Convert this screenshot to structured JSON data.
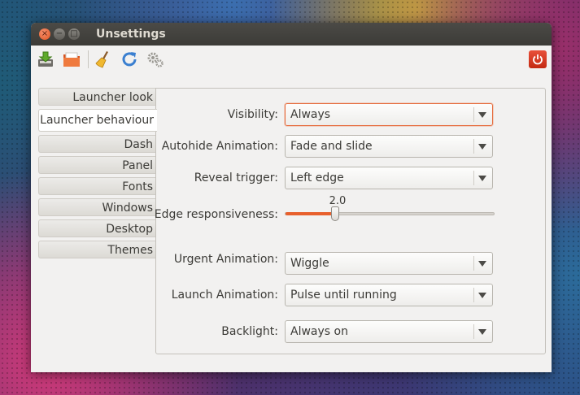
{
  "window": {
    "title": "Unsettings",
    "controls": [
      "close",
      "minimize",
      "maximize"
    ]
  },
  "toolbar": {
    "icons": [
      "save-icon",
      "open-folder-icon",
      "broom-icon",
      "refresh-icon",
      "gears-icon",
      "power-icon"
    ]
  },
  "sidebar": {
    "items": [
      {
        "label": "Launcher look",
        "active": false
      },
      {
        "label": "Launcher behaviour",
        "active": true
      },
      {
        "label": "Dash",
        "active": false
      },
      {
        "label": "Panel",
        "active": false
      },
      {
        "label": "Fonts",
        "active": false
      },
      {
        "label": "Windows",
        "active": false
      },
      {
        "label": "Desktop",
        "active": false
      },
      {
        "label": "Themes",
        "active": false
      }
    ]
  },
  "settings": {
    "visibility": {
      "label": "Visibility:",
      "value": "Always"
    },
    "autohide_animation": {
      "label": "Autohide Animation:",
      "value": "Fade and slide"
    },
    "reveal_trigger": {
      "label": "Reveal trigger:",
      "value": "Left edge"
    },
    "edge_responsiveness": {
      "label": "Edge responsiveness:",
      "value": "2.0",
      "fraction": 0.24
    },
    "urgent_animation": {
      "label": "Urgent Animation:",
      "value": "Wiggle"
    },
    "launch_animation": {
      "label": "Launch Animation:",
      "value": "Pulse until running"
    },
    "backlight": {
      "label": "Backlight:",
      "value": "Always on"
    }
  },
  "colors": {
    "accent": "#e8602c",
    "titlebar": "#3c3b37",
    "power_button": "#d6381e"
  }
}
